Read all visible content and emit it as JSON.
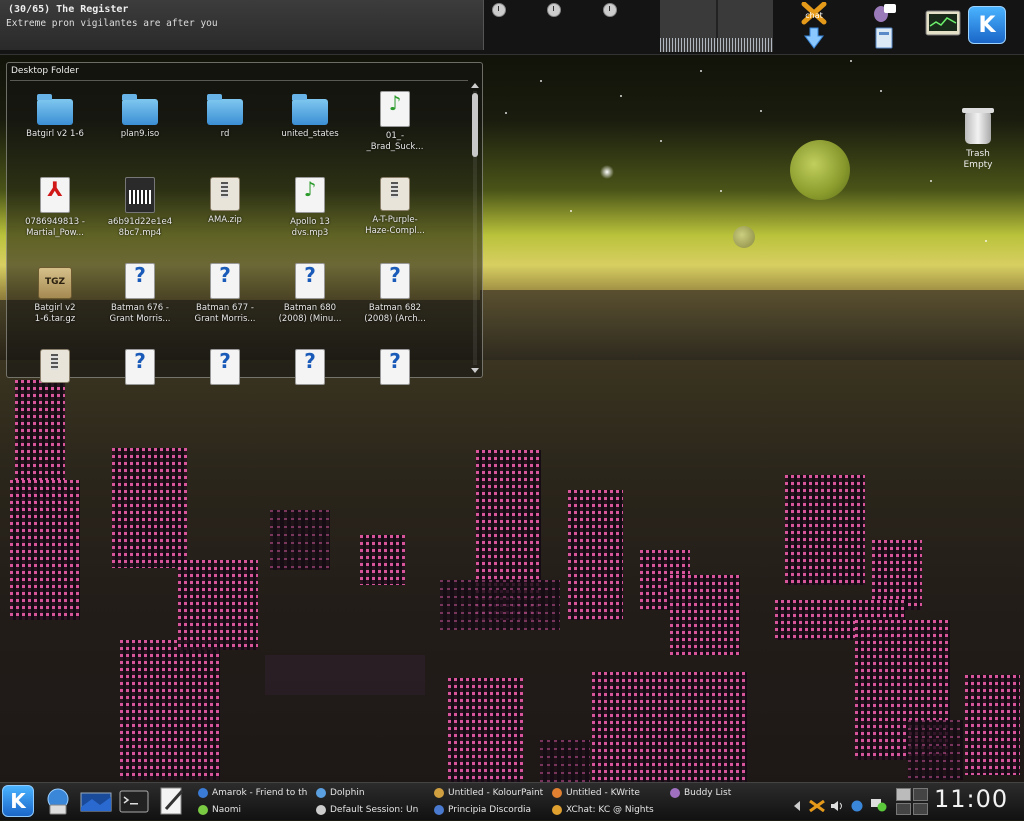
{
  "news_ticker": {
    "title": "(30/65) The Register",
    "headline": "Extreme pron vigilantes are after you"
  },
  "desktop_folder": {
    "title": "Desktop Folder",
    "files": [
      {
        "line1": "Batgirl v2 1-6",
        "line2": "",
        "type": "folder"
      },
      {
        "line1": "plan9.iso",
        "line2": "",
        "type": "folder"
      },
      {
        "line1": "rd",
        "line2": "",
        "type": "folder"
      },
      {
        "line1": "united_states",
        "line2": "",
        "type": "folder"
      },
      {
        "line1": "01_-",
        "line2": "_Brad_Suck...",
        "type": "audio"
      },
      {
        "line1": "0786949813 -",
        "line2": "Martial_Pow...",
        "type": "pdf"
      },
      {
        "line1": "a6b91d22e1e4",
        "line2": "8bc7.mp4",
        "type": "movie"
      },
      {
        "line1": "AMA.zip",
        "line2": "",
        "type": "zip"
      },
      {
        "line1": "Apollo 13",
        "line2": "dvs.mp3",
        "type": "audio"
      },
      {
        "line1": "A-T-Purple-",
        "line2": "Haze-Compl...",
        "type": "zip"
      },
      {
        "line1": "Batgirl v2",
        "line2": "1-6.tar.gz",
        "type": "tgz"
      },
      {
        "line1": "Batman 676 -",
        "line2": "Grant Morris...",
        "type": "unknown"
      },
      {
        "line1": "Batman 677 -",
        "line2": "Grant Morris...",
        "type": "unknown"
      },
      {
        "line1": "Batman 680",
        "line2": "(2008) (Minu...",
        "type": "unknown"
      },
      {
        "line1": "Batman 682",
        "line2": "(2008) (Arch...",
        "type": "unknown"
      },
      {
        "line1": "",
        "line2": "",
        "type": "zip"
      },
      {
        "line1": "",
        "line2": "",
        "type": "unknown"
      },
      {
        "line1": "",
        "line2": "",
        "type": "unknown"
      },
      {
        "line1": "",
        "line2": "",
        "type": "unknown"
      },
      {
        "line1": "",
        "line2": "",
        "type": "unknown"
      }
    ],
    "tgz_glyph": "TGZ",
    "unknown_glyph": "?",
    "audio_glyph": "♪",
    "pdf_glyph": "⅄"
  },
  "trash": {
    "label_line1": "Trash",
    "label_line2": "Empty"
  },
  "top_panel": {
    "kmenu_glyph": "K",
    "chat_label": "chat"
  },
  "taskbar": {
    "kmenu_glyph": "K",
    "tasks_row1": [
      {
        "label": "Amarok - Friend to th",
        "color": "#3a7bd5"
      },
      {
        "label": "Dolphin",
        "color": "#5aa0e0"
      },
      {
        "label": "Untitled - KolourPaint",
        "color": "#d0a040"
      },
      {
        "label": "Untitled - KWrite",
        "color": "#e08030"
      },
      {
        "label": "Buddy List",
        "color": "#a070c0"
      }
    ],
    "tasks_row2": [
      {
        "label": "Naomi",
        "color": "#7ac943"
      },
      {
        "label": "Default Session: Un",
        "color": "#cccccc"
      },
      {
        "label": "Principia Discordia",
        "color": "#4a7ad0"
      },
      {
        "label": "XChat: KC @ Nights",
        "color": "#e0a030"
      }
    ],
    "clock": "11:00"
  },
  "colors": {
    "accent_blue": "#2a80e0",
    "window_pink": "#e85aa8"
  }
}
